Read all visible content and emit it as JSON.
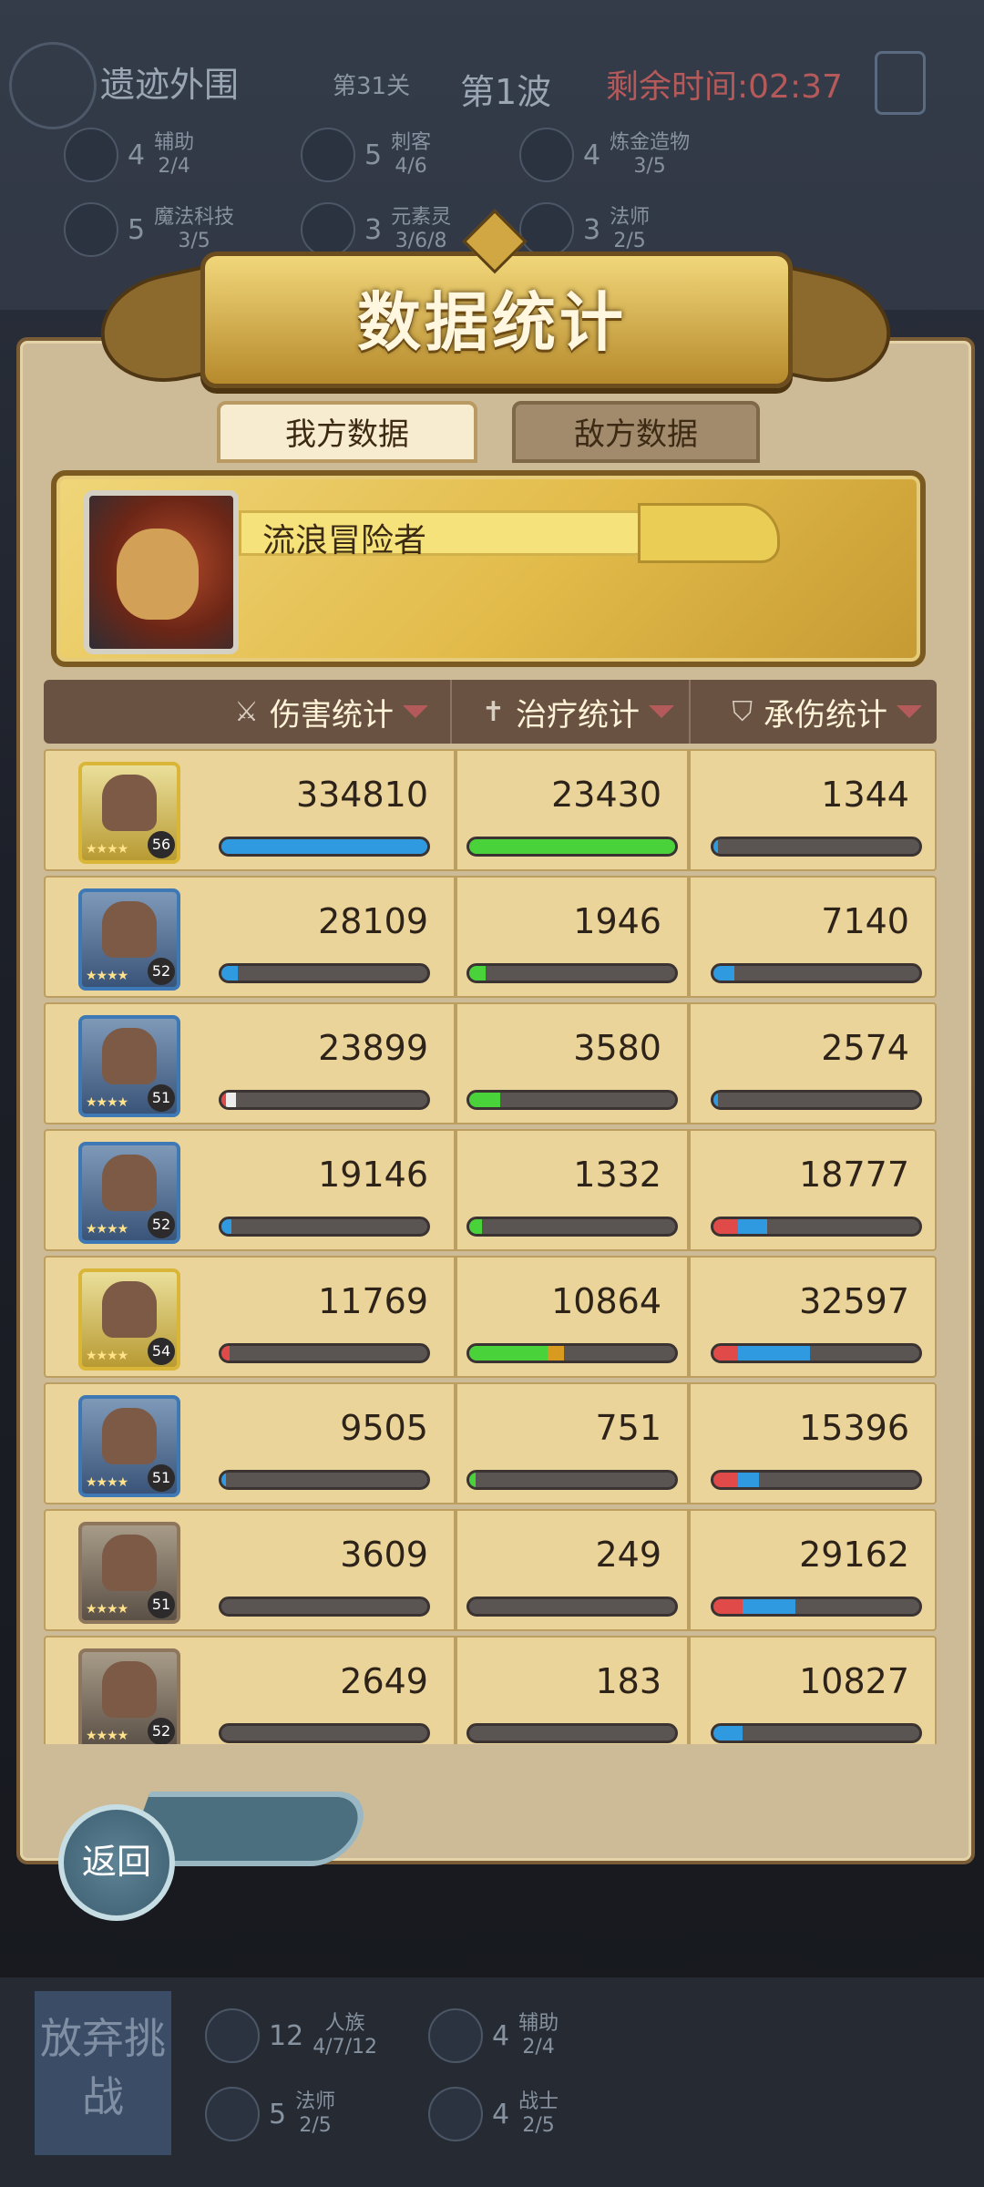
{
  "background": {
    "title": "遗迹外围",
    "stage": "第31关",
    "wave": "第1波",
    "timer": "剩余时间:02:37",
    "traits_top": [
      {
        "count": "4",
        "name": "辅助",
        "progress": "2/4"
      },
      {
        "count": "5",
        "name": "刺客",
        "progress": "4/6"
      },
      {
        "count": "4",
        "name": "炼金造物",
        "progress": "3/5"
      },
      {
        "count": "5",
        "name": "魔法科技",
        "progress": "3/5"
      },
      {
        "count": "3",
        "name": "元素灵",
        "progress": "3/6/8"
      },
      {
        "count": "3",
        "name": "法师",
        "progress": "2/5"
      }
    ],
    "give_up": "放弃挑战",
    "traits_bottom": [
      {
        "count": "12",
        "name": "人族",
        "progress": "4/7/12"
      },
      {
        "count": "4",
        "name": "辅助",
        "progress": "2/4"
      },
      {
        "count": "5",
        "name": "法师",
        "progress": "2/5"
      },
      {
        "count": "4",
        "name": "战士",
        "progress": "2/5"
      }
    ]
  },
  "panel": {
    "title": "数据统计",
    "tabs": {
      "mine": "我方数据",
      "enemy": "敌方数据"
    },
    "player_name": "流浪冒险者",
    "headers": {
      "damage": "伤害统计",
      "heal": "治疗统计",
      "tank": "承伤统计"
    },
    "back_label": "返回"
  },
  "rows": [
    {
      "level": "56",
      "frame": "gold",
      "damage": "334810",
      "heal": "23430",
      "tank": "1344",
      "damage_fill": [
        {
          "color": "blue",
          "pct": 100
        }
      ],
      "heal_fill": [
        {
          "color": "green",
          "pct": 100
        }
      ],
      "tank_fill": [
        {
          "color": "blue",
          "pct": 2
        }
      ]
    },
    {
      "level": "52",
      "frame": "blue",
      "damage": "28109",
      "heal": "1946",
      "tank": "7140",
      "damage_fill": [
        {
          "color": "blue",
          "pct": 8
        }
      ],
      "heal_fill": [
        {
          "color": "green",
          "pct": 8
        }
      ],
      "tank_fill": [
        {
          "color": "blue",
          "pct": 10
        }
      ]
    },
    {
      "level": "51",
      "frame": "blue",
      "damage": "23899",
      "heal": "3580",
      "tank": "2574",
      "damage_fill": [
        {
          "color": "red",
          "pct": 2
        },
        {
          "color": "white",
          "pct": 5
        }
      ],
      "heal_fill": [
        {
          "color": "green",
          "pct": 15
        }
      ],
      "tank_fill": [
        {
          "color": "blue",
          "pct": 2
        }
      ]
    },
    {
      "level": "52",
      "frame": "blue",
      "damage": "19146",
      "heal": "1332",
      "tank": "18777",
      "damage_fill": [
        {
          "color": "blue",
          "pct": 5
        }
      ],
      "heal_fill": [
        {
          "color": "green",
          "pct": 6
        }
      ],
      "tank_fill": [
        {
          "color": "red",
          "pct": 12
        },
        {
          "color": "blue",
          "pct": 14
        }
      ]
    },
    {
      "level": "54",
      "frame": "gold",
      "damage": "11769",
      "heal": "10864",
      "tank": "32597",
      "damage_fill": [
        {
          "color": "red",
          "pct": 4
        }
      ],
      "heal_fill": [
        {
          "color": "green",
          "pct": 38
        },
        {
          "color": "orange",
          "pct": 8
        }
      ],
      "tank_fill": [
        {
          "color": "red",
          "pct": 12
        },
        {
          "color": "blue",
          "pct": 35
        }
      ]
    },
    {
      "level": "51",
      "frame": "blue",
      "damage": "9505",
      "heal": "751",
      "tank": "15396",
      "damage_fill": [
        {
          "color": "blue",
          "pct": 2
        }
      ],
      "heal_fill": [
        {
          "color": "green",
          "pct": 3
        }
      ],
      "tank_fill": [
        {
          "color": "red",
          "pct": 12
        },
        {
          "color": "blue",
          "pct": 10
        }
      ]
    },
    {
      "level": "51",
      "frame": "bronze",
      "damage": "3609",
      "heal": "249",
      "tank": "29162",
      "damage_fill": [],
      "heal_fill": [],
      "tank_fill": [
        {
          "color": "red",
          "pct": 14
        },
        {
          "color": "blue",
          "pct": 26
        }
      ]
    },
    {
      "level": "52",
      "frame": "bronze",
      "damage": "2649",
      "heal": "183",
      "tank": "10827",
      "damage_fill": [],
      "heal_fill": [],
      "tank_fill": [
        {
          "color": "blue",
          "pct": 14
        }
      ]
    }
  ]
}
